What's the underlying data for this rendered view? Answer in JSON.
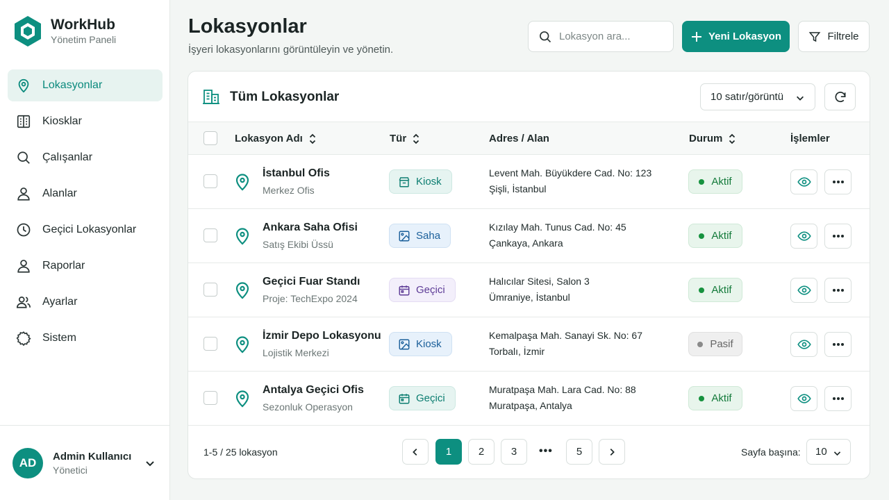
{
  "brand": {
    "title": "WorkHub",
    "subtitle": "Yönetim Paneli"
  },
  "sidebar": {
    "items": [
      {
        "label": "Lokasyonlar",
        "icon": "map-pin-icon",
        "active": true
      },
      {
        "label": "Kiosklar",
        "icon": "building-icon"
      },
      {
        "label": "Çalışanlar",
        "icon": "search-icon"
      },
      {
        "label": "Alanlar",
        "icon": "user-icon"
      },
      {
        "label": "Geçici Lokasyonlar",
        "icon": "clock-icon"
      },
      {
        "label": "Raporlar",
        "icon": "user-icon"
      },
      {
        "label": "Ayarlar",
        "icon": "users-icon"
      },
      {
        "label": "Sistem",
        "icon": "gear-icon"
      }
    ]
  },
  "user": {
    "initials": "AD",
    "name": "Admin Kullanıcı",
    "role": "Yönetici"
  },
  "header": {
    "title": "Lokasyonlar",
    "subtitle": "İşyeri lokasyonlarını görüntüleyin ve yönetin.",
    "search_placeholder": "Lokasyon ara...",
    "new_button": "Yeni Lokasyon",
    "filter_button": "Filtrele"
  },
  "card": {
    "title": "Tüm Lokasyonlar",
    "rows_select": "10 satır/görüntü"
  },
  "table": {
    "columns": {
      "name": "Lokasyon Adı",
      "type": "Tür",
      "address": "Adres / Alan",
      "status": "Durum",
      "actions": "İşlemler"
    },
    "rows": [
      {
        "name": "İstanbul Ofis",
        "sub": "Merkez Ofis",
        "type": "Kiosk",
        "type_style": "kiosk-green",
        "type_icon": "kiosk-icon",
        "addr1": "Levent Mah. Büyükdere Cad. No: 123",
        "addr2": "Şişli, İstanbul",
        "status": "Aktif",
        "status_style": "aktif"
      },
      {
        "name": "Ankara Saha Ofisi",
        "sub": "Satış Ekibi Üssü",
        "type": "Saha",
        "type_style": "saha",
        "type_icon": "image-icon",
        "addr1": "Kızılay Mah. Tunus Cad. No: 45",
        "addr2": "Çankaya, Ankara",
        "status": "Aktif",
        "status_style": "aktif"
      },
      {
        "name": "Geçici Fuar Standı",
        "sub": "Proje: TechExpo 2024",
        "type": "Geçici",
        "type_style": "gecici",
        "type_icon": "calendar-icon",
        "addr1": "Halıcılar Sitesi, Salon 3",
        "addr2": "Ümraniye, İstanbul",
        "status": "Aktif",
        "status_style": "aktif"
      },
      {
        "name": "İzmir Depo Lokasyonu",
        "sub": "Lojistik Merkezi",
        "type": "Kiosk",
        "type_style": "kiosk-blue",
        "type_icon": "image-icon",
        "addr1": "Kemalpaşa Mah. Sanayi Sk. No: 67",
        "addr2": "Torbalı, İzmir",
        "status": "Pasif",
        "status_style": "pasif"
      },
      {
        "name": "Antalya Geçici Ofis",
        "sub": "Sezonluk Operasyon",
        "type": "Geçici",
        "type_style": "gecici-green",
        "type_icon": "calendar-icon",
        "addr1": "Muratpaşa Mah. Lara Cad. No: 88",
        "addr2": "Muratpaşa, Antalya",
        "status": "Aktif",
        "status_style": "aktif"
      }
    ]
  },
  "pagination": {
    "info": "1-5 / 25 lokasyon",
    "pages": [
      "1",
      "2",
      "3",
      "5"
    ],
    "active_page": "1",
    "ellipsis": "•••",
    "per_page_label": "Sayfa başına:",
    "per_page_value": "10"
  },
  "colors": {
    "accent": "#0d8f80",
    "active_bg": "#e7f3f0"
  }
}
